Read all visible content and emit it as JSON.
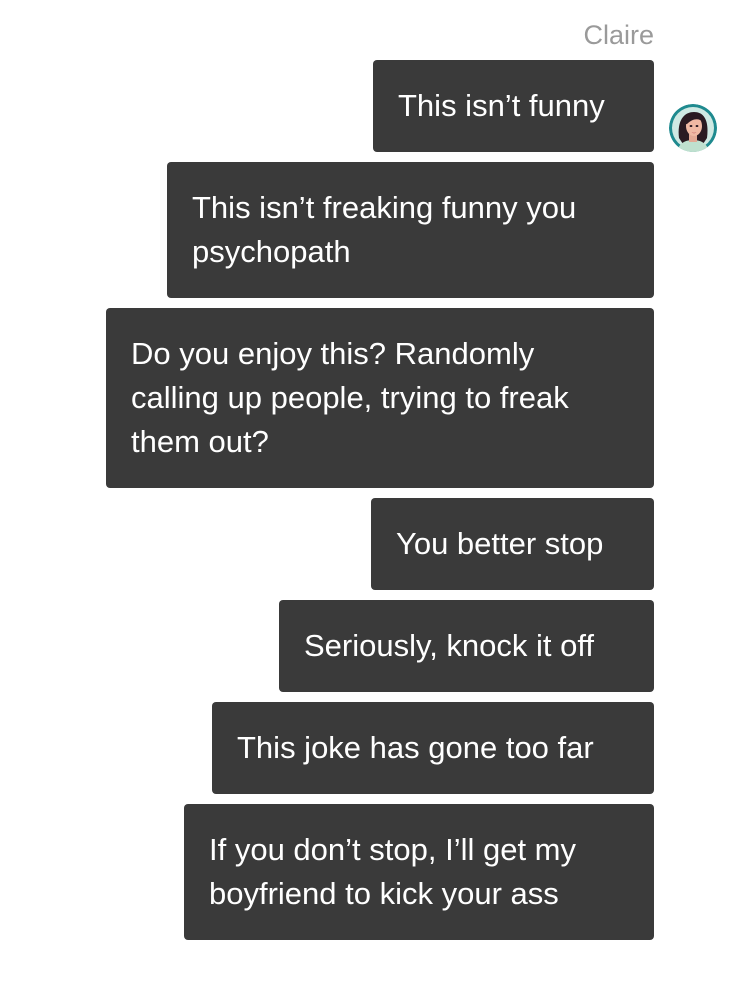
{
  "conversation": {
    "sender_name": "Claire",
    "avatar_icon": "woman-portrait-avatar",
    "messages": [
      {
        "text": "This isn’t funny"
      },
      {
        "text": "This isn’t freaking funny you psychopath"
      },
      {
        "text": "Do you enjoy this? Randomly calling up people, trying to freak them out?"
      },
      {
        "text": "You better stop"
      },
      {
        "text": "Seriously, knock it off"
      },
      {
        "text": "This joke has gone too far"
      },
      {
        "text": "If you don’t stop, I’ll get my boyfriend to kick your ass"
      }
    ]
  },
  "colors": {
    "bubble_background": "#3a3a3a",
    "bubble_text": "#ffffff",
    "sender_name": "#9a9a9a",
    "avatar_ring": "#1f8a8f"
  }
}
